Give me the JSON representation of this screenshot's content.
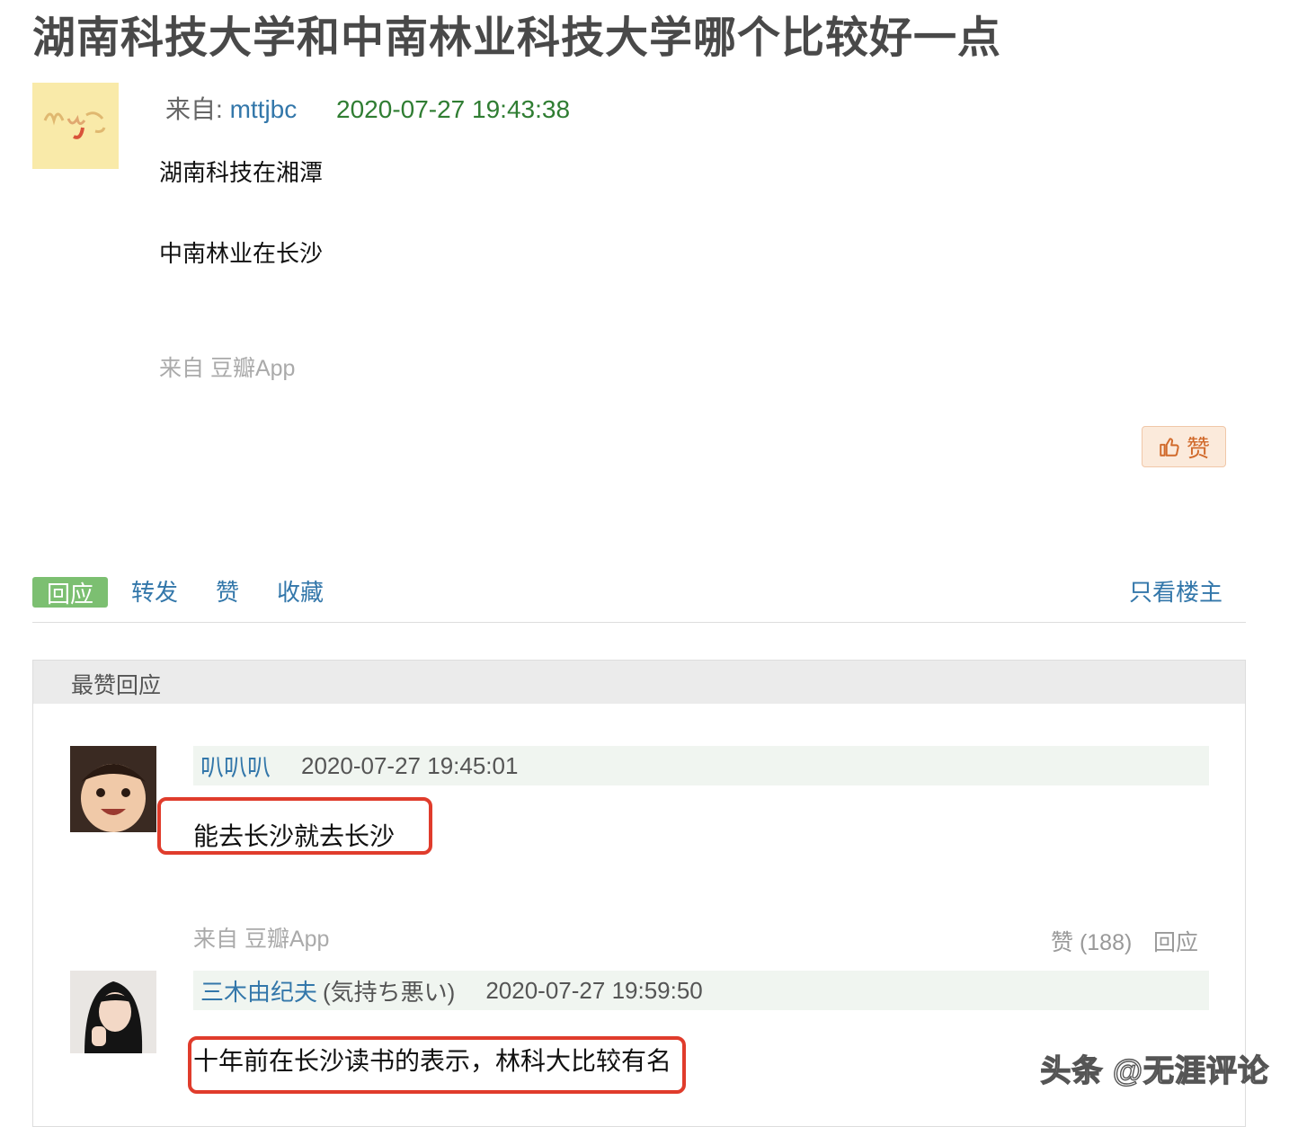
{
  "topic": {
    "title": "湖南科技大学和中南林业科技大学哪个比较好一点"
  },
  "op": {
    "from_label": "来自:",
    "username": "mttjbc",
    "time": "2020-07-27 19:43:38",
    "paragraph1": "湖南科技在湘潭",
    "paragraph2": "中南林业在长沙",
    "via": "来自 豆瓣App",
    "like_label": "赞"
  },
  "actions": {
    "reply": "回应",
    "share": "转发",
    "like": "赞",
    "collect": "收藏",
    "only_op": "只看楼主"
  },
  "best_replies": {
    "header": "最赞回应",
    "items": [
      {
        "username": "叭叭叭",
        "note": "",
        "time": "2020-07-27 19:45:01",
        "text": "能去长沙就去长沙",
        "via": "来自 豆瓣App",
        "likes": "赞 (188)",
        "reply": "回应"
      },
      {
        "username": "三木由纪夫",
        "note": "(気持ち悪い)",
        "time": "2020-07-27 19:59:50",
        "text": "十年前在长沙读书的表示，林科大比较有名"
      }
    ]
  },
  "watermark": "头条 @无涯评论",
  "colors": {
    "link": "#3377aa",
    "timestamp": "#2f7d32",
    "reply_tab": "#7cbf71",
    "highlight_box": "#e03c2c",
    "like_button": "#d16a2b"
  }
}
